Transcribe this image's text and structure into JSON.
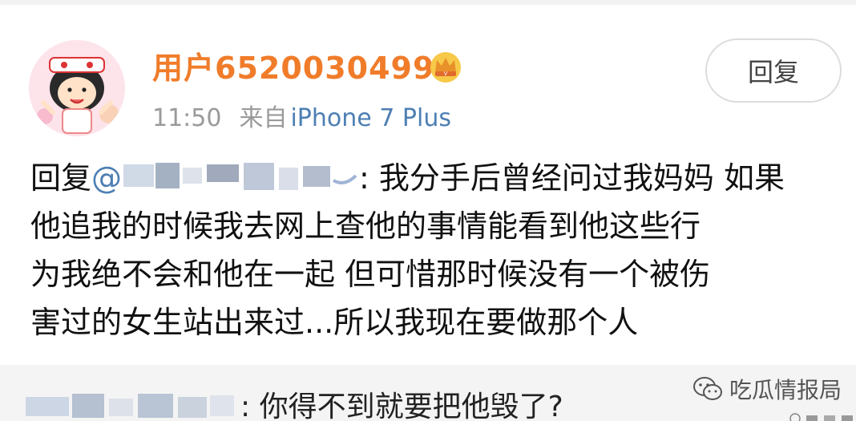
{
  "post": {
    "username": "用户6520030499",
    "time": "11:50",
    "source_prefix": "来自",
    "source_device": "iPhone 7 Plus",
    "reply_button_label": "回复",
    "reply_prefix": "回复",
    "mention_at": "@",
    "mention_tail": ":",
    "body_line1": " 我分手后曾经问过我妈妈 如果",
    "body_line2": "他追我的时候我去网上查他的事情能看到他这些行",
    "body_line3": "为我绝不会和他在一起 但可惜那时候没有一个被伤",
    "body_line4": "害过的女生站出来过...所以我现在要做那个人"
  },
  "sub_comment": {
    "text": ": 你得不到就要把他毁了?"
  },
  "watermark": {
    "text": "吃瓜情报局"
  },
  "colors": {
    "username": "#f07c2a",
    "source_link": "#4d7fb3",
    "meta": "#9a9a9a",
    "sub_bg": "#f4f4f4"
  },
  "icons": [
    "avatar-icon",
    "vip-crown-icon",
    "wechat-icon"
  ]
}
